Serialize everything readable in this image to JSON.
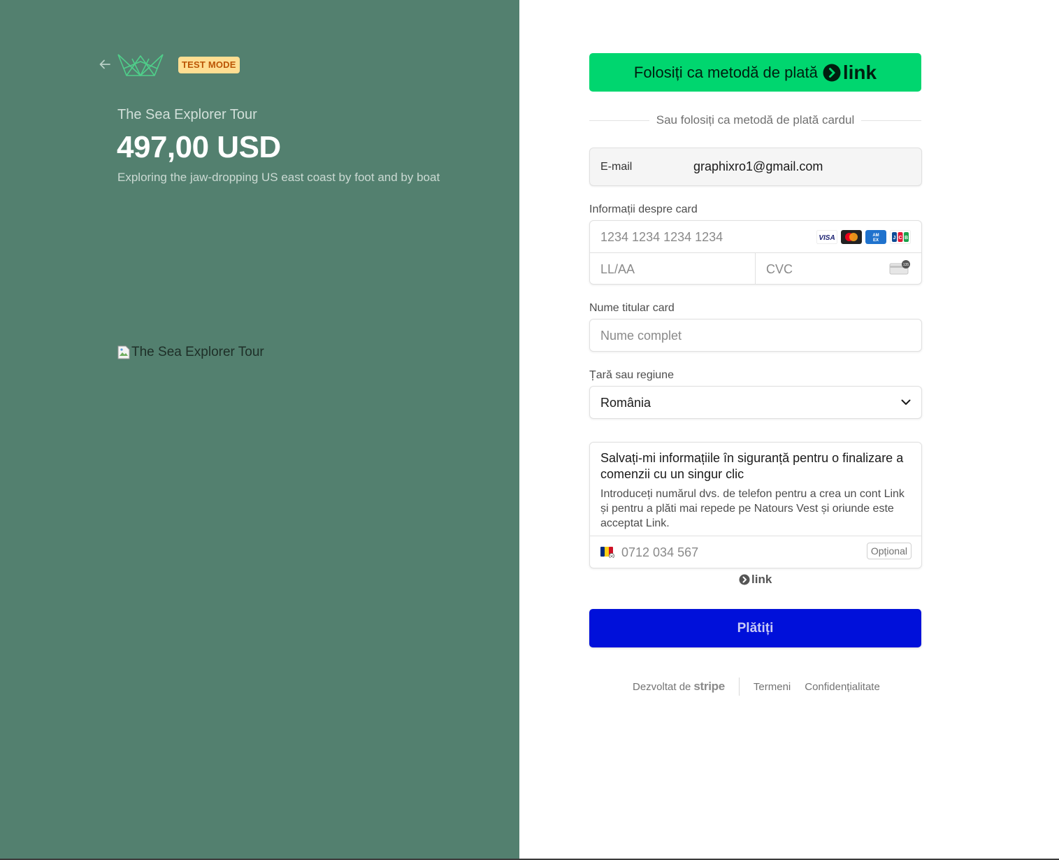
{
  "badge": "TEST MODE",
  "product": {
    "name": "The Sea Explorer Tour",
    "price": "497,00 USD",
    "description": "Exploring the jaw-dropping US east coast by foot and by boat",
    "image_alt": "The Sea Explorer Tour"
  },
  "link_button": {
    "label": "Folosiți ca metodă de plată",
    "brand": "link"
  },
  "divider_text": "Sau folosiți ca metodă de plată cardul",
  "email": {
    "label": "E-mail",
    "value": "graphixro1@gmail.com"
  },
  "card": {
    "label": "Informații despre card",
    "number_placeholder": "1234 1234 1234 1234",
    "expiry_placeholder": "LL/AA",
    "cvc_placeholder": "CVC",
    "brands": [
      "visa-icon",
      "mastercard-icon",
      "amex-icon",
      "jcb-icon"
    ]
  },
  "cardholder": {
    "label": "Nume titular card",
    "placeholder": "Nume complet"
  },
  "country": {
    "label": "Țară sau regiune",
    "value": "România"
  },
  "save_info": {
    "title": "Salvați-mi informațiile în siguranță pentru o finalizare a comenzii cu un singur clic",
    "subtitle": "Introduceți numărul dvs. de telefon pentru a crea un cont Link și pentru a plăti mai repede pe Natours Vest și oriunde este acceptat Link.",
    "phone_placeholder": "0712 034 567",
    "optional": "Opțional",
    "link_brand": "link"
  },
  "pay_button": "Plătiți",
  "footer": {
    "powered_by": "Dezvoltat de",
    "stripe": "stripe",
    "terms": "Termeni",
    "privacy": "Confidențialitate"
  },
  "colors": {
    "left_bg": "#53806f",
    "link_green": "#00d66f",
    "pay_blue": "#0010da",
    "badge_bg": "#ffde92",
    "badge_text": "#bb5504"
  }
}
